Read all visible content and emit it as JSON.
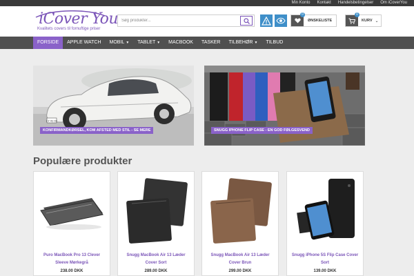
{
  "topbar": {
    "links": [
      "Min Konto",
      "Kontakt",
      "Handelsbetingelser",
      "Om iCoverYou"
    ]
  },
  "logo": {
    "name": "iCover You",
    "tagline": "Kvalitets covers til fornuftige priser"
  },
  "search": {
    "placeholder": "Søg produkter..."
  },
  "header": {
    "wishlist_label": "ØNSKELISTE",
    "wishlist_count": "0",
    "cart_label": "KURV",
    "cart_count": "0"
  },
  "nav": {
    "items": [
      {
        "label": "FORSIDE",
        "caret": ""
      },
      {
        "label": "APPLE WATCH",
        "caret": ""
      },
      {
        "label": "MOBIL",
        "caret": "▼"
      },
      {
        "label": "TABLET",
        "caret": "▼"
      },
      {
        "label": "MACBOOK",
        "caret": ""
      },
      {
        "label": "TASKER",
        "caret": ""
      },
      {
        "label": "TILBEHØR",
        "caret": "▼"
      },
      {
        "label": "TILBUD",
        "caret": ""
      }
    ]
  },
  "banners": [
    {
      "caption": "KONFIRMANDKØRSEL, KOM AFSTED MED STIL - SE MERE",
      "plate": "LY 41 02"
    },
    {
      "caption": "SNUGG IPHONE FLIP CASE - EN GOD FØLGESVEND"
    }
  ],
  "products": {
    "title": "Populære produkter",
    "items": [
      {
        "name": "Puro MacBook Pro 13 Clever Sleeve Mørkegrå",
        "price": "238.00 DKK"
      },
      {
        "name": "Snugg MacBook Air 13 Læder Cover Sort",
        "price": "289.00 DKK"
      },
      {
        "name": "Snugg MacBook Air 13 Læder Cover Brun",
        "price": "299.00 DKK"
      },
      {
        "name": "Snugg iPhone 5S Flip Case Cover Sort",
        "price": "139.00 DKK"
      }
    ]
  },
  "colors": {
    "accent": "#8a62c9",
    "nav": "#505050",
    "topbar": "#3a3a3a",
    "info": "#3f8fc9"
  }
}
